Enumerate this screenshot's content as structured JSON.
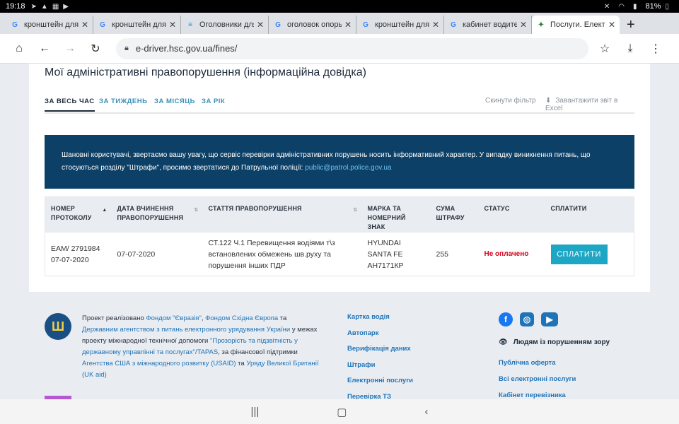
{
  "status_bar": {
    "time": "19:18",
    "battery": "81%"
  },
  "browser": {
    "tabs": [
      {
        "label": "кронштейн для с",
        "fav": "G",
        "color": "#4285f4"
      },
      {
        "label": "кронштейн для с",
        "fav": "G",
        "color": "#4285f4"
      },
      {
        "label": "Оголовники для",
        "fav": "≡",
        "color": "#2a8fd8"
      },
      {
        "label": "оголовок опоры",
        "fav": "G",
        "color": "#4285f4"
      },
      {
        "label": "кронштейн для с",
        "fav": "G",
        "color": "#4285f4"
      },
      {
        "label": "кабинет водител",
        "fav": "G",
        "color": "#4285f4"
      },
      {
        "label": "Послуги. Електр",
        "fav": "✦",
        "color": "#2e7d32"
      }
    ],
    "url": "e-driver.hsc.gov.ua/fines/"
  },
  "page": {
    "title": "Мої адміністративні правопорушення (інформаційна довідка)",
    "filter_tabs": [
      "ЗА ВЕСЬ ЧАС",
      "ЗА ТИЖДЕНЬ",
      "ЗА МІСЯЦЬ",
      "ЗА РІК"
    ],
    "reset_filter": "Скинути фільтр",
    "download_excel": "Завантажити звіт в Excel",
    "notice_text": "Шановні користувачі, звертаємо вашу увагу, що сервіс перевірки адміністративних порушень носить інформативний характер. У випадку виникнення питань, що стосуються розділу \"Штрафи\", просимо звертатися до Патрульної поліції:",
    "notice_email": "public@patrol.police.gov.ua",
    "table": {
      "headers": {
        "protocol": [
          "НОМЕР",
          "ПРОТОКОЛУ"
        ],
        "date": [
          "ДАТА ВЧИНЕННЯ",
          "ПРАВОПОРУШЕННЯ"
        ],
        "article": [
          "СТАТТЯ ПРАВОПОРУШЕННЯ"
        ],
        "car": [
          "МАРКА ТА",
          "НОМЕРНИЙ ЗНАК"
        ],
        "sum": [
          "СУМА",
          "ШТРАФУ"
        ],
        "status": [
          "СТАТУС"
        ],
        "pay": [
          "СПЛАТИТИ"
        ]
      },
      "row": {
        "protocol": [
          "ЕАМ/ 2791984",
          "07-07-2020"
        ],
        "date": "07-07-2020",
        "article": [
          "СТ.122 Ч.1 Перевищення водіями т\\з",
          "встановлених обмежень шв.руху та",
          "порушення інших ПДР"
        ],
        "car": [
          "HYUNDAI",
          "SANTA FE",
          "АН7171КР"
        ],
        "sum": "255",
        "status": "Не оплачено",
        "pay_label": "СПЛАТИТИ"
      }
    }
  },
  "footer": {
    "text_lines": [
      [
        "Проект реалізовано ",
        "Фондом \"Євразія\"",
        ", ",
        "Фондом Східна Європа",
        " та"
      ],
      [
        "Державним агентством з питань електронного урядування України",
        "  у межах"
      ],
      [
        "проекту міжнародної технічної допомоги  ",
        "\"Прозорість та підзвітність у"
      ],
      [
        "державному управлінні та послугах\"/TAPAS",
        ",  за фінансової підтримки"
      ],
      [
        "Агентства США з міжнародного розвитку (USAID)",
        "  та  ",
        "Уряду Великої Британії"
      ],
      [
        "(UK aid)"
      ]
    ],
    "links_col1": [
      "Картка водія",
      "Автопарк",
      "Верифікація даних",
      "Штрафи",
      "Електронні послуги",
      "Перевірка ТЗ"
    ],
    "vision_label": "Людям із порушенням зору",
    "links_col2": [
      "Публічна оферта",
      "Всі електронні послуги",
      "Кабінет перевізника"
    ]
  }
}
